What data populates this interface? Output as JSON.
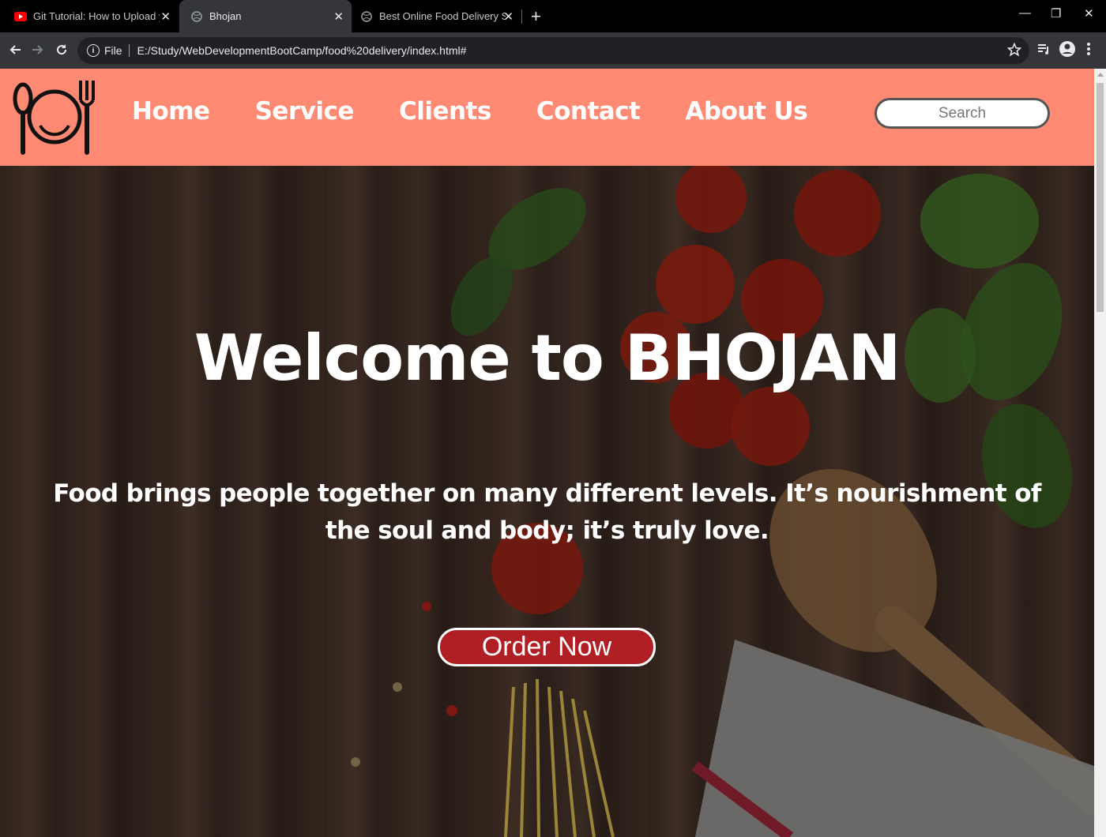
{
  "browser": {
    "tabs": [
      {
        "title": "Git Tutorial: How to Upload your",
        "icon": "youtube-icon"
      },
      {
        "title": "Bhojan",
        "icon": "globe-icon"
      },
      {
        "title": "Best Online Food Delivery Service",
        "icon": "globe-icon"
      }
    ],
    "address": {
      "scheme_label": "File",
      "url": "E:/Study/WebDevelopmentBootCamp/food%20delivery/index.html#"
    }
  },
  "page": {
    "nav": {
      "links": [
        "Home",
        "Service",
        "Clients",
        "Contact",
        "About Us"
      ],
      "search_placeholder": "Search"
    },
    "hero": {
      "title": "Welcome to BHOJAN",
      "tagline": "Food brings people together on many different levels. It’s nourishment of the soul and body; it’s truly love.",
      "cta": "Order Now"
    }
  },
  "colors": {
    "nav_bg": "#ff8a73",
    "cta_bg": "#b01f24"
  }
}
